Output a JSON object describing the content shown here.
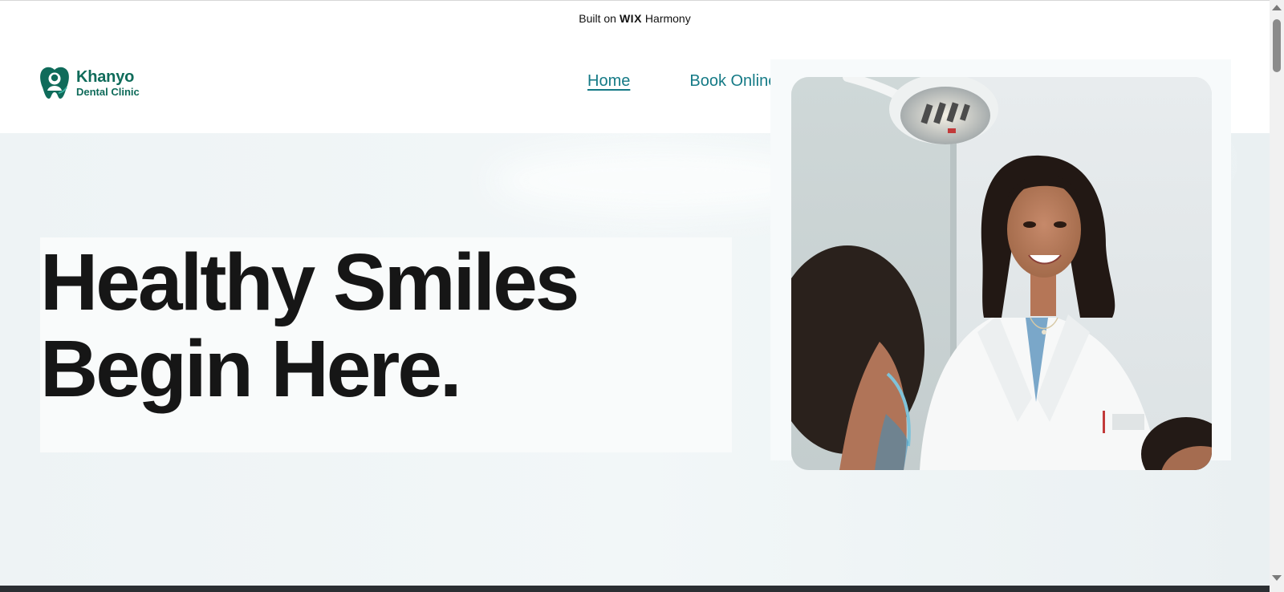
{
  "banner": {
    "built_on": "Built on",
    "brand": "WIX",
    "product": "Harmony"
  },
  "header": {
    "logo": {
      "name": "Khanyo",
      "subtitle": "Dental Clinic",
      "icon": "tooth-person-logo-icon"
    },
    "nav": [
      {
        "label": "Home",
        "active": true
      },
      {
        "label": "Book Online",
        "active": false
      }
    ]
  },
  "hero": {
    "headline_line1": "Healthy Smiles",
    "headline_line2": "Begin Here.",
    "image": "dentist-smiling-with-patient-photo"
  },
  "colors": {
    "brand_green": "#0f6b5a",
    "nav_link": "#157a86",
    "headline": "#161616",
    "hero_bg": "#eef3f5"
  }
}
